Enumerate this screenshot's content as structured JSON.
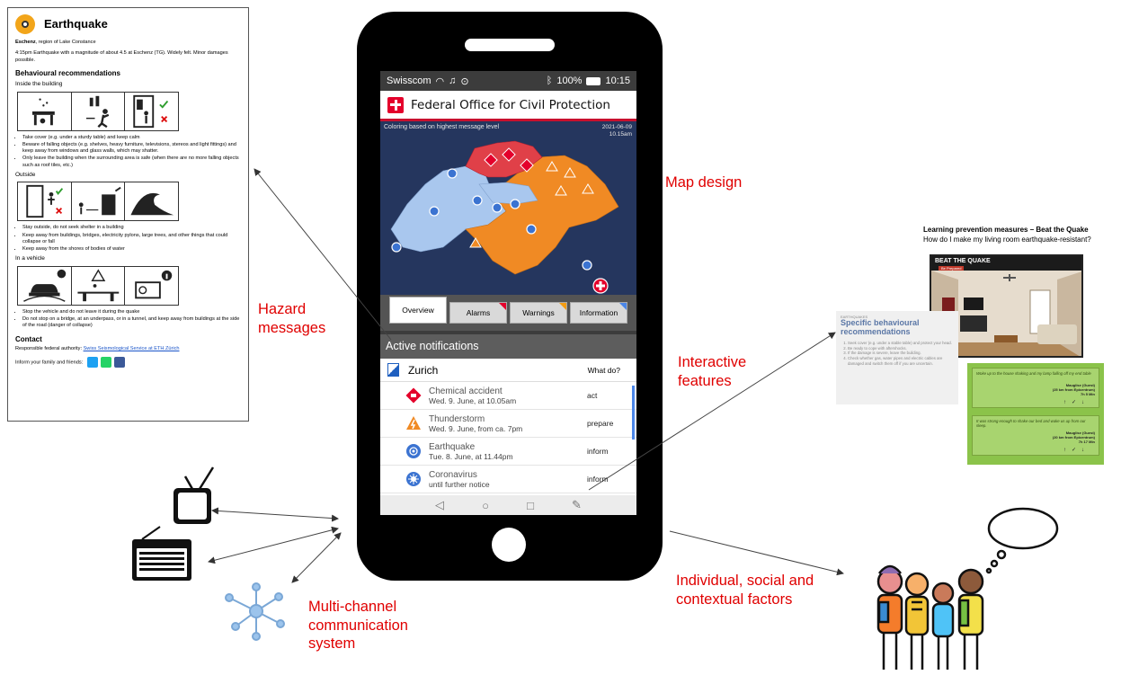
{
  "doc": {
    "title": "Earthquake",
    "location_place": "Eschenz",
    "location_rest": ", region of Lake Constance",
    "message": "4:15pm Earthquake with a magnitude of about 4.5 at Eschenz (TG). Widely felt. Minor damages possible.",
    "recommendations_heading": "Behavioural recommendations",
    "inside_heading": "Inside the building",
    "inside_items": [
      "Take cover (e.g. under a sturdy table) and keep calm",
      "Beware of falling objects (e.g. shelves, heavy furniture, televisions, stereos and light fittings) and keep away from windows and glass walls, which may shatter.",
      "Only leave the building when the surrounding area is safe (when there are no more falling objects such as roof tiles, etc.)"
    ],
    "outside_heading": "Outside",
    "outside_items": [
      "Stay outside, do not seek shelter in a building",
      "Keep away from buildings, bridges, electricity pylons, large trees, and other things that could collapse or fall",
      "Keep away from the shores of bodies of water"
    ],
    "vehicle_heading": "In a vehicle",
    "vehicle_items": [
      "Stop the vehicle and do not leave it during the quake",
      "Do not stop on a bridge, at an underpass, or in a tunnel, and keep away from buildings at the side of the road (danger of collapse)"
    ],
    "contact_heading": "Contact",
    "authority_label": "Responsible federal authority: ",
    "authority_link": "Swiss Seismological Service at ETH Zürich",
    "inform_label": "Inform your family and friends:"
  },
  "phone": {
    "status": {
      "carrier": "Swisscom",
      "battery": "100%",
      "time": "10:15"
    },
    "app_title": "Federal Office for Civil Protection",
    "map_caption": "Coloring based on highest message level",
    "map_date": "2021-06-09",
    "map_time": "10.15am",
    "tabs": [
      {
        "label": "Overview",
        "corner": ""
      },
      {
        "label": "Alarms",
        "corner": "#e4002b"
      },
      {
        "label": "Warnings",
        "corner": "#f39c12"
      },
      {
        "label": "Information",
        "corner": "#4a86e8"
      }
    ],
    "active_notifications": "Active notifications",
    "region": "Zurich",
    "what_do": "What do?",
    "notifications": [
      {
        "title": "Chemical accident",
        "when": "Wed. 9. June, at 10.05am",
        "level": "act",
        "icon": "chemical-accident-icon",
        "color": "#e4002b"
      },
      {
        "title": "Thunderstorm",
        "when": "Wed. 9. June, from ca. 7pm",
        "level": "prepare",
        "icon": "thunderstorm-icon",
        "color": "#f08a24"
      },
      {
        "title": "Earthquake",
        "when": "Tue. 8. June, at 11.44pm",
        "level": "inform",
        "icon": "earthquake-icon",
        "color": "#3b73d1"
      },
      {
        "title": "Coronavirus",
        "when": "until further notice",
        "level": "inform",
        "icon": "coronavirus-icon",
        "color": "#3b73d1"
      }
    ]
  },
  "labels": {
    "map_design": "Map design",
    "hazard_messages": "Hazard messages",
    "interactive_features": "Interactive features",
    "multichannel": "Multi-channel communication system",
    "factors": "Individual, social and contextual factors"
  },
  "learn": {
    "title": "Learning prevention measures –",
    "title_tail": "Beat the Quake",
    "subtitle": "How do I make my living room earthquake-resistant?",
    "game_title": "BEAT THE QUAKE",
    "game_badge": "Be Prepared"
  },
  "behaviour_card": {
    "kicker": "EARTHQUAKES",
    "heading": "Specific behavioural recommendations",
    "items": [
      "Seek cover (e.g. under a stable table) and protect your head.",
      "Be ready to cope with aftershocks.",
      "If the damage is severe, leave the building.",
      "Check whether gas, water pipes and electric cables are damaged and switch them off if you are uncertain."
    ]
  },
  "chat": {
    "posts": [
      {
        "text": "Woke up to the house shaking and my lamp falling off my end table",
        "author": "Mauglise (Guest)",
        "distance": "(25 km from Epicentrum)",
        "time": "7h 5 Min"
      },
      {
        "text": "It was strong enough to shake our bed and wake us up from our sleep.",
        "author": "Mauglise (Guest)",
        "distance": "(20 km from Epicentrum)",
        "time": "7h 17 Min"
      }
    ]
  }
}
